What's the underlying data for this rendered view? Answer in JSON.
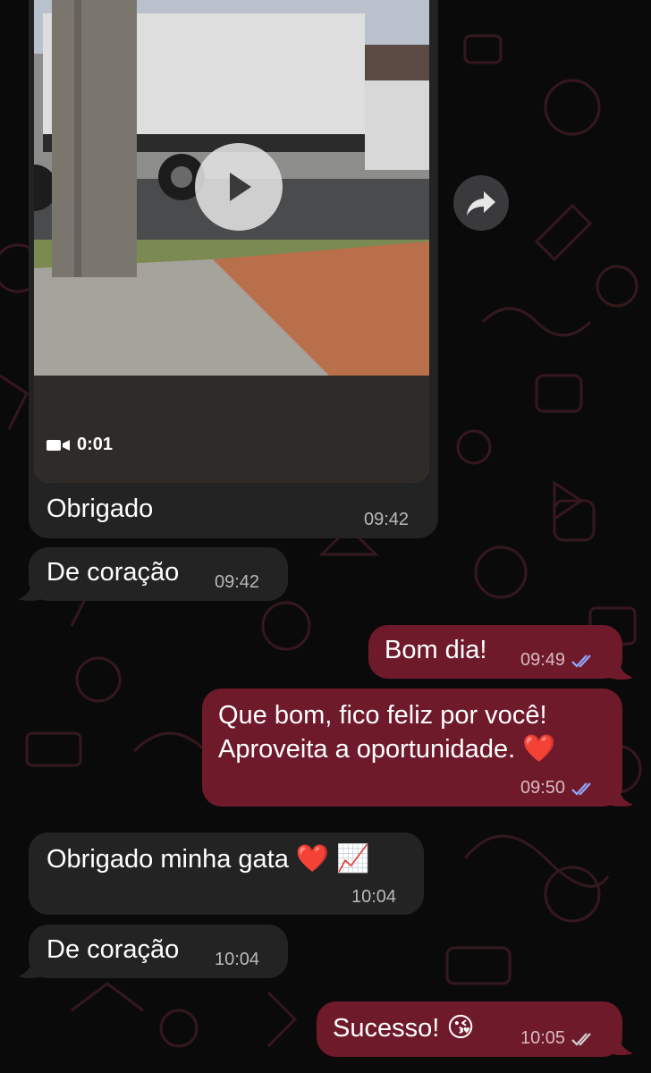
{
  "colors": {
    "background": "#0b0a0a",
    "incoming_bubble": "#232323",
    "outgoing_bubble": "#6f1a2b",
    "read_check": "#8fa8ff",
    "delivered_check": "#d0d0d0"
  },
  "video_message": {
    "duration": "0:01",
    "caption": "Obrigado",
    "time": "09:42"
  },
  "messages": [
    {
      "text": "De coração",
      "time": "09:42"
    },
    {
      "text": "Bom dia!",
      "time": "09:49",
      "status": "read"
    },
    {
      "line1": "Que bom, fico feliz por você!",
      "line2": "Aproveita a oportunidade.",
      "emoji": "❤️",
      "time": "09:50",
      "status": "read"
    },
    {
      "text": "Obrigado minha gata",
      "emoji1": "❤️",
      "emoji2": "📈",
      "time": "10:04"
    },
    {
      "text": "De coração",
      "time": "10:04"
    },
    {
      "text": "Sucesso!",
      "emoji": "😘",
      "time": "10:05",
      "status": "delivered"
    }
  ]
}
